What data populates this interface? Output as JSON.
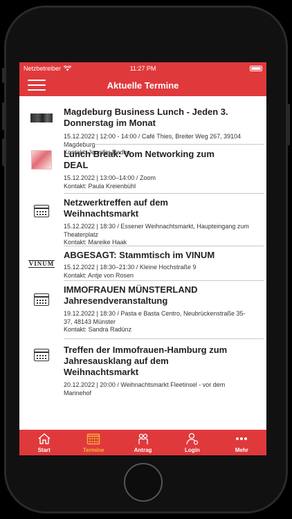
{
  "status": {
    "carrier": "Netzbetreiber",
    "time": "11:27 PM"
  },
  "header": {
    "title": "Aktuelle Termine",
    "menu_icon": "hamburger-menu-icon"
  },
  "events": [
    {
      "title": "Magdeburg Business Lunch - Jeden 3. Donnerstag im Monat",
      "details": "15.12.2022 | 12:00 - 14:00  / Café Thies, Breiter Weg 267, 39104 Magdeburg",
      "contact": "Kontakt: Jennifer Radke",
      "thumb": "photo"
    },
    {
      "title": "Lunch Break: Vom Networking zum DEAL",
      "details": "15.12.2022 | 13:00–14:00 / Zoom",
      "contact": "Kontakt: Paula Kreienbühl",
      "thumb": "photo"
    },
    {
      "title": "Netzwerktreffen auf dem Weihnachtsmarkt",
      "details": "15.12.2022 | 18:30 / Essener Weihnachtsmarkt, Haupteingang zum Theaterplatz",
      "contact": "Kontakt: Mareike Haak",
      "thumb": "calendar-icon"
    },
    {
      "title": "ABGESAGT: Stammtisch im VINUM",
      "details": "15.12.2022 | 18:30–21:30 / Kleine Hochstraße 9",
      "contact": "Kontakt: Antje von Rosen",
      "thumb": "logo",
      "logo_text": "VINUM"
    },
    {
      "title": "IMMOFRAUEN MÜNSTERLAND Jahresendveranstaltung",
      "details": "19.12.2022 | 18:30 / Pasta e Basta Centro, Neubrückenstraße 35-37, 48143 Münster",
      "contact": "Kontakt: Sandra Radünz",
      "thumb": "calendar-icon"
    },
    {
      "title": "Treffen der Immofrauen-Hamburg zum Jahresausklang auf dem Weihnachtsmarkt",
      "details": "20.12.2022 | 20:00 / Weihnachtsmarkt Fleetinsel - vor dem Marinehof",
      "contact": "",
      "thumb": "calendar-icon"
    }
  ],
  "tabs": [
    {
      "label": "Start",
      "icon": "home-icon",
      "active": false
    },
    {
      "label": "Termine",
      "icon": "calendar-icon",
      "active": true
    },
    {
      "label": "Antrag",
      "icon": "people-icon",
      "active": false
    },
    {
      "label": "Login",
      "icon": "user-icon",
      "active": false
    },
    {
      "label": "Mehr",
      "icon": "more-icon",
      "active": false
    }
  ],
  "colors": {
    "accent": "#e0393c",
    "active_tab": "#f5b335"
  }
}
